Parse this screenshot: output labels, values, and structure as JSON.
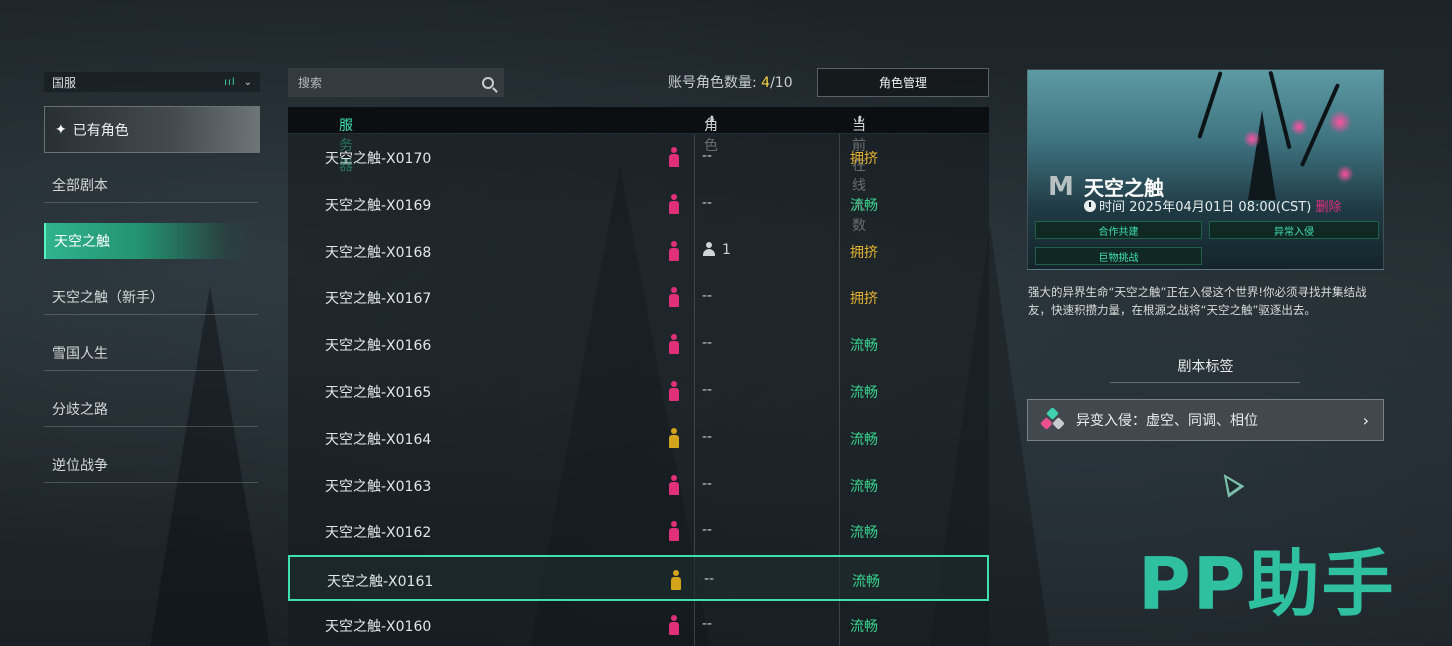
{
  "region": {
    "label": "国服",
    "signal": "ııl",
    "chevron": "⌄"
  },
  "owned": {
    "label": "已有角色"
  },
  "nav": [
    {
      "label": "全部剧本"
    },
    {
      "label": "天空之触"
    },
    {
      "label": "天空之触（新手）"
    },
    {
      "label": "雪国人生"
    },
    {
      "label": "分歧之路"
    },
    {
      "label": "逆位战争"
    }
  ],
  "search": {
    "placeholder": "搜索"
  },
  "account": {
    "prefix": "账号角色数量: ",
    "current": "4",
    "suffix": "/10"
  },
  "manage_button": "角色管理",
  "table": {
    "headers": {
      "server": "服务器",
      "character": "角色",
      "online": "当前在线人数"
    },
    "sort_server": "⌄",
    "sort_other": "⬍",
    "rows": [
      {
        "name": "天空之触-X0170",
        "figure": "pink",
        "character": "--",
        "status": "拥挤",
        "status_type": "crowded"
      },
      {
        "name": "天空之触-X0169",
        "figure": "pink",
        "character": "--",
        "status": "流畅",
        "status_type": "smooth"
      },
      {
        "name": "天空之触-X0168",
        "figure": "pink",
        "character": "1",
        "status": "拥挤",
        "status_type": "crowded",
        "has_user": true
      },
      {
        "name": "天空之触-X0167",
        "figure": "pink",
        "character": "--",
        "status": "拥挤",
        "status_type": "crowded"
      },
      {
        "name": "天空之触-X0166",
        "figure": "pink",
        "character": "--",
        "status": "流畅",
        "status_type": "smooth"
      },
      {
        "name": "天空之触-X0165",
        "figure": "pink",
        "character": "--",
        "status": "流畅",
        "status_type": "smooth"
      },
      {
        "name": "天空之触-X0164",
        "figure": "yellow",
        "character": "--",
        "status": "流畅",
        "status_type": "smooth"
      },
      {
        "name": "天空之触-X0163",
        "figure": "pink",
        "character": "--",
        "status": "流畅",
        "status_type": "smooth"
      },
      {
        "name": "天空之触-X0162",
        "figure": "pink",
        "character": "--",
        "status": "流畅",
        "status_type": "smooth"
      },
      {
        "name": "天空之触-X0161",
        "figure": "yellow",
        "character": "--",
        "status": "流畅",
        "status_type": "smooth",
        "selected": true
      },
      {
        "name": "天空之触-X0160",
        "figure": "pink",
        "character": "--",
        "status": "流畅",
        "status_type": "smooth"
      }
    ]
  },
  "scenario": {
    "logo": "M",
    "title": "天空之触",
    "time_label": "时间 2025年04月01日 08:00(CST)",
    "time_more": "删除",
    "tags": [
      "合作共建",
      "异常入侵",
      "巨物挑战"
    ],
    "description": "强大的异界生命“天空之触”正在入侵这个世界!你必须寻找并集结战友，快速积攒力量，在根源之战将“天空之触”驱逐出去。",
    "tags_title": "剧本标签",
    "tag_row": "异变入侵：虚空、同调、相位",
    "tag_arrow": "›"
  },
  "watermark": "PP助手",
  "colors": {
    "accent": "#3fe0b0",
    "smooth": "#39d48e",
    "crowded": "#e0b030",
    "pink": "#e0307a",
    "yellow": "#d4a41c"
  }
}
